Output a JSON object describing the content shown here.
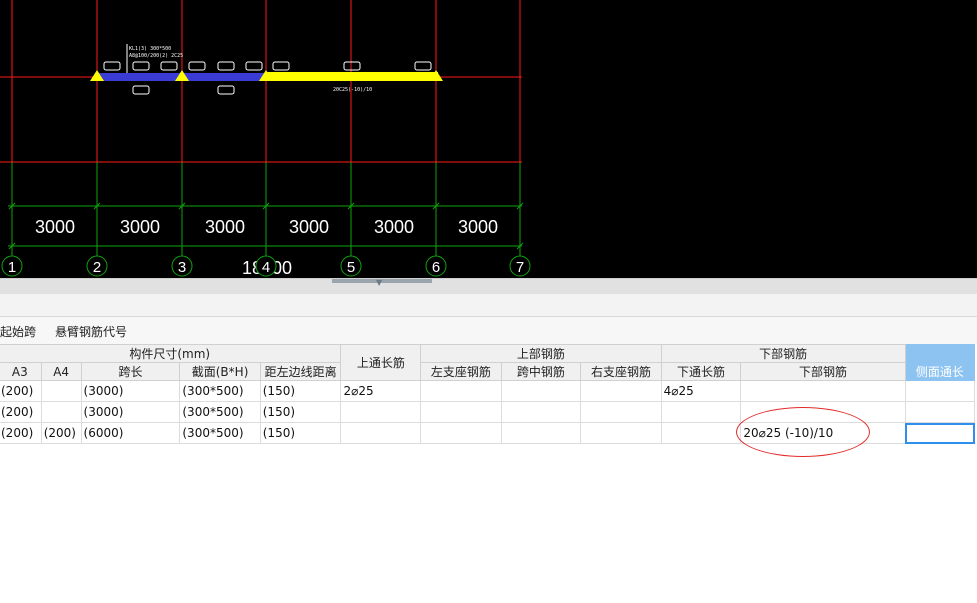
{
  "cad": {
    "span_label": "3000",
    "total_label": "18000",
    "axis_numbers": [
      "1",
      "2",
      "3",
      "4",
      "5",
      "6",
      "7"
    ],
    "beam_text_line1": "KL1(3) 300*500",
    "beam_text_line2": "A8@100/200(2) 2C25",
    "beam_text_right": "20C25(-10)/10",
    "colors": {
      "grid_red": "#ff1a1a",
      "grid_green": "#0fa30f",
      "beam_blue": "#3b3bd6",
      "beam_yellow": "#ffff00",
      "background": "#000000"
    }
  },
  "toolbar": {
    "switch_start_span": "换起始跨",
    "cantilever_code": "悬臂钢筋代号"
  },
  "table": {
    "group_headers": {
      "dimensions": "构件尺寸(mm)",
      "top_through": "上通长筋",
      "top_rebar": "上部钢筋",
      "bottom_rebar": "下部钢筋",
      "side_through": "侧面通长"
    },
    "columns": {
      "a3": "A3",
      "a4": "A4",
      "span_length": "跨长",
      "section": "截面(B*H)",
      "left_edge_dist": "距左边线距离",
      "left_support": "左支座钢筋",
      "mid_span": "跨中钢筋",
      "right_support": "右支座钢筋",
      "bottom_through": "下通长筋",
      "bottom_rebar": "下部钢筋"
    },
    "rows": [
      {
        "a3": "(200)",
        "a4": "",
        "span": "(3000)",
        "section": "(300*500)",
        "dist": "(150)",
        "top_through": "2⌀25",
        "left_support": "",
        "mid_span": "",
        "right_support": "",
        "bottom_through": "4⌀25",
        "bottom": "",
        "side": ""
      },
      {
        "a3": "(200)",
        "a4": "",
        "span": "(3000)",
        "section": "(300*500)",
        "dist": "(150)",
        "top_through": "",
        "left_support": "",
        "mid_span": "",
        "right_support": "",
        "bottom_through": "",
        "bottom": "",
        "side": ""
      },
      {
        "a3": "(200)",
        "a4": "(200)",
        "span": "(6000)",
        "section": "(300*500)",
        "dist": "(150)",
        "top_through": "",
        "left_support": "",
        "mid_span": "",
        "right_support": "",
        "bottom_through": "",
        "bottom": "20⌀25 (-10)/10",
        "side": ""
      }
    ]
  }
}
